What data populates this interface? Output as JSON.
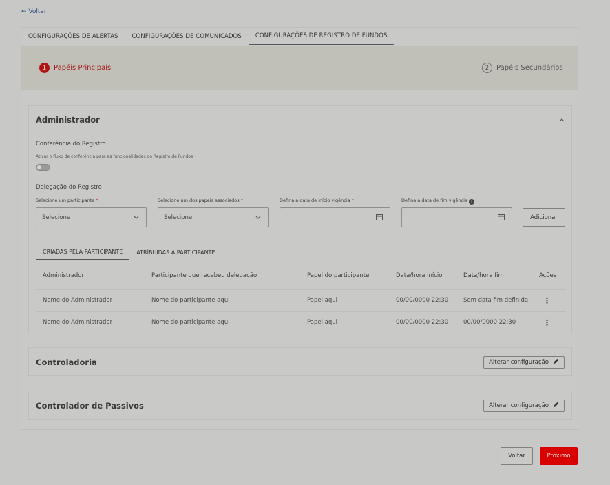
{
  "nav": {
    "back_label": "← Voltar"
  },
  "tabs": [
    {
      "label": "CONFIGURAÇÕES DE ALERTAS"
    },
    {
      "label": "CONFIGURAÇÕES DE COMUNICADOS"
    },
    {
      "label": "CONFIGURAÇÕES DE REGISTRO DE FUNDOS",
      "active": true
    }
  ],
  "stepper": {
    "steps": [
      {
        "number": "1",
        "label": "Papéis Principais"
      },
      {
        "number": "2",
        "label": "Papéis Secundários"
      }
    ]
  },
  "admin": {
    "title": "Administrador",
    "conferencia_title": "Conferência do Registro",
    "conferencia_desc": "Ativar o fluxo de conferência para as funcionalidades do Registro de Fundos",
    "delegacao_title": "Delegação do Registro",
    "fields": [
      {
        "label": "Selecione um participante",
        "required": "*",
        "value": "Selecione"
      },
      {
        "label": "Selecione um dos papeis associados",
        "required": "*",
        "value": "Selecione"
      },
      {
        "label": "Defina a data de início vigência",
        "required": "*",
        "value": ""
      },
      {
        "label": "Defina a data de fim vigência",
        "value": ""
      }
    ],
    "add_label": "Adicionar",
    "subtabs": [
      "CRIADAS PELA PARTICIPANTE",
      "ATRÍBUIDAS À PARTICIPANTE"
    ],
    "table": {
      "headers": [
        "Administrador",
        "Participante que recebeu delegação",
        "Papel do participante",
        "Data/hora início",
        "Data/hora fim",
        "Ações"
      ],
      "rows": [
        [
          "Nome do Administrador",
          "Nome do participante aqui",
          "Papel aqui",
          "00/00/0000 22:30",
          "Sem data fim definida"
        ],
        [
          "Nome do Administrador",
          "Nome do participante aqui",
          "Papel aqui",
          "00/00/0000 22:30",
          "00/00/0000 22:30"
        ]
      ]
    }
  },
  "controladoria": {
    "title": "Controladoria",
    "button": "Alterar configuração"
  },
  "controlador_passivos": {
    "title": "Controlador de Passivos",
    "button": "Alterar configuração"
  },
  "footer": {
    "back_label": "Voltar",
    "next_label": "Próximo"
  },
  "colors": {
    "primary_red": "#d90000",
    "step_active": "#b01515"
  },
  "icons": [
    "arrow-left-icon",
    "chevron-up-icon",
    "chevron-down-icon",
    "calendar-icon",
    "info-icon",
    "kebab-menu-icon",
    "pencil-icon"
  ]
}
